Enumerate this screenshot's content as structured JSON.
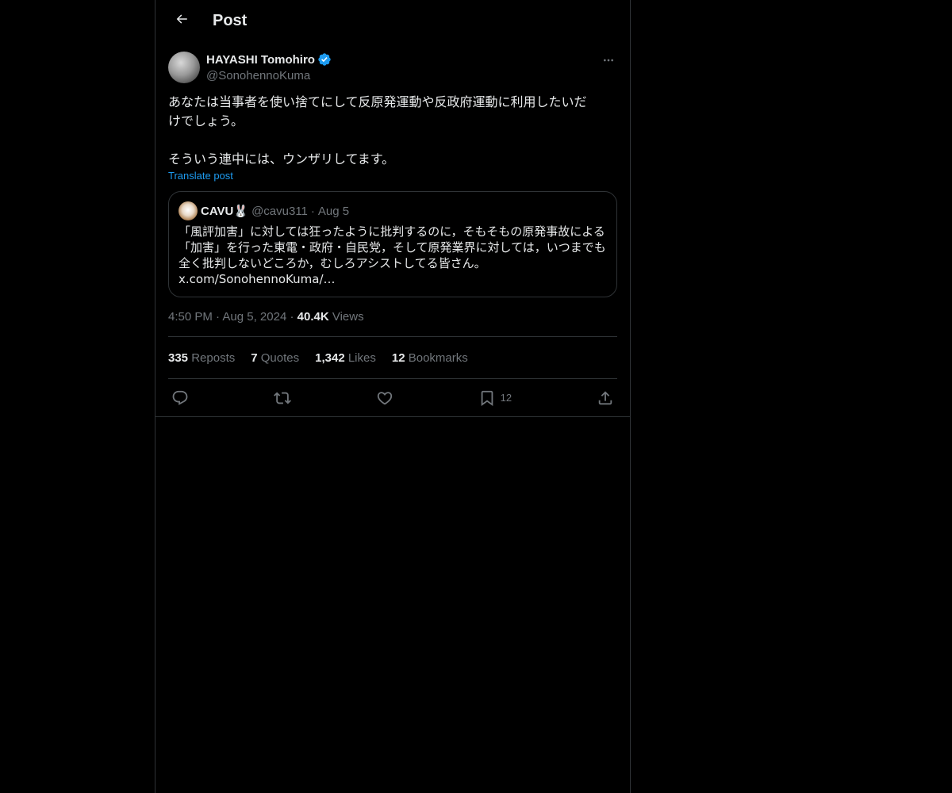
{
  "header": {
    "title": "Post"
  },
  "post": {
    "author_name": "HAYASHI Tomohiro",
    "author_handle": "@SonohennoKuma",
    "text_line1": "あなたは当事者を使い捨てにして反原発運動や反政府運動に利用したいだ",
    "text_line2": "けでしょう。",
    "text_line3": "そういう連中には、ウンザリしてます。",
    "translate_label": "Translate post",
    "time": "4:50 PM",
    "date": "Aug 5, 2024",
    "views_count": "40.4K",
    "views_label": "Views",
    "separator": "·"
  },
  "quote": {
    "name": "CAVU🐰",
    "handle": "@cavu311",
    "separator": "·",
    "date": "Aug 5",
    "line1": "「風評加害」に対しては狂ったように批判するのに，そもそもの原発事故による",
    "line2": "「加害」を行った東電・政府・自民党，そして原発業界に対しては，いつまでも",
    "line3": "全く批判しないどころか，むしろアシストしてる皆さん。",
    "line4": "x.com/SonohennoKuma/…"
  },
  "stats": {
    "reposts_count": "335",
    "reposts_label": "Reposts",
    "quotes_count": "7",
    "quotes_label": "Quotes",
    "likes_count": "1,342",
    "likes_label": "Likes",
    "bookmarks_count": "12",
    "bookmarks_label": "Bookmarks"
  },
  "actions": {
    "bookmark_count": "12"
  },
  "icons": {
    "back": "arrow-left-icon",
    "verified": "verified-badge-icon",
    "more": "more-dots-icon",
    "reply": "reply-icon",
    "repost": "repost-icon",
    "like": "heart-icon",
    "bookmark": "bookmark-icon",
    "share": "share-icon"
  },
  "colors": {
    "background": "#000000",
    "text": "#e7e9ea",
    "muted": "#71767b",
    "accent": "#1d9bf0",
    "border": "#2f3336"
  }
}
